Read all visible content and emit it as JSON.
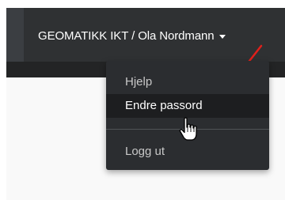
{
  "navbar": {
    "user_menu_label": "GEOMATIKK IKT / Ola Nordmann"
  },
  "dropdown": {
    "items": [
      {
        "label": "Hjelp"
      },
      {
        "label": "Endre passord"
      },
      {
        "label": "Logg ut"
      }
    ]
  },
  "colors": {
    "navbar": "#2f3133",
    "dropdown": "#2b2d30",
    "highlight": "#1d1e20",
    "annotation_arrow": "#e0201b"
  },
  "icons": {
    "user_caret": "chevron-down-icon",
    "cursor": "hand-pointer-icon",
    "annotation": "red-arrow-icon"
  }
}
